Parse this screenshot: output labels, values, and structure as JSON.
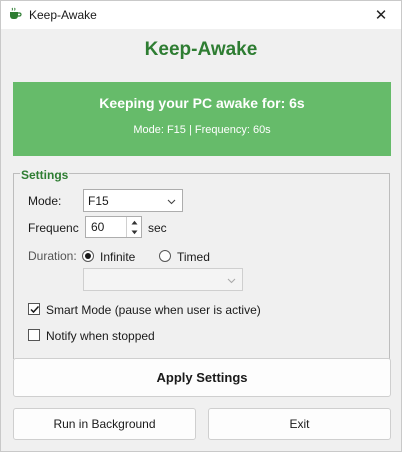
{
  "window": {
    "title": "Keep-Awake",
    "close_glyph": "✕"
  },
  "header": {
    "title": "Keep-Awake"
  },
  "status": {
    "main": "Keeping your PC awake for: 6s",
    "sub": "Mode: F15 | Frequency: 60s",
    "color": "#66bb6a"
  },
  "settings": {
    "legend": "Settings",
    "mode": {
      "label": "Mode:",
      "value": "F15"
    },
    "frequency": {
      "label": "Frequenc",
      "value": "60",
      "unit": "sec"
    },
    "duration": {
      "label": "Duration:",
      "options": [
        "Infinite",
        "Timed"
      ],
      "selected": "Infinite",
      "timed_value": ""
    },
    "smart_mode": {
      "label": "Smart Mode (pause when user is active)",
      "checked": true
    },
    "notify": {
      "label": "Notify when stopped",
      "checked": false
    }
  },
  "buttons": {
    "apply": "Apply Settings",
    "background": "Run in Background",
    "exit": "Exit"
  },
  "colors": {
    "accent": "#2e7d32",
    "panel": "#66bb6a",
    "icon": "#2e7d32"
  },
  "icons": {
    "app": "coffee-cup-icon",
    "close": "close-icon",
    "dropdown": "chevron-down-icon"
  }
}
